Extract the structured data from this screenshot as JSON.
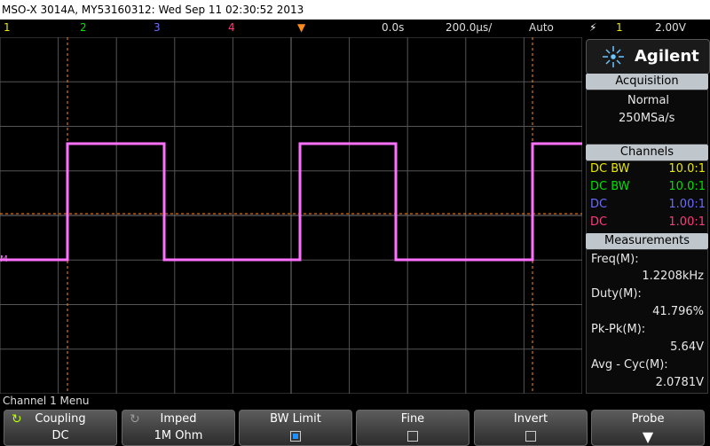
{
  "title_bar": "MSO-X 3014A, MY53160312: Wed Sep 11 02:30:52 2013",
  "top_bar": {
    "channels": [
      {
        "label": "1",
        "color": "#e8e800"
      },
      {
        "label": "2",
        "color": "#00e000"
      },
      {
        "label": "3",
        "color": "#6b6bff"
      },
      {
        "label": "4",
        "color": "#ff3a7a"
      }
    ],
    "time_delay": "0.0s",
    "time_scale": "200.0µs/",
    "trigger_mode": "Auto",
    "trigger_source": "1",
    "trigger_level": "2.00V"
  },
  "colors": {
    "trace": "#ff70ff",
    "cursor": "#ff8c1a",
    "grid": "#555555"
  },
  "brand": "Agilent",
  "acquisition": {
    "header": "Acquisition",
    "mode": "Normal",
    "rate": "250MSa/s"
  },
  "channels_panel": {
    "header": "Channels",
    "rows": [
      {
        "left": "DC BW",
        "right": "10.0:1",
        "color": "#e8e800"
      },
      {
        "left": "DC BW",
        "right": "10.0:1",
        "color": "#00e000"
      },
      {
        "left": "DC",
        "right": "1.00:1",
        "color": "#6b6bff"
      },
      {
        "left": "DC",
        "right": "1.00:1",
        "color": "#ff3a7a"
      }
    ]
  },
  "measurements": {
    "header": "Measurements",
    "items": [
      {
        "name": "Freq(M):",
        "value": "1.2208kHz"
      },
      {
        "name": "Duty(M):",
        "value": "41.796%"
      },
      {
        "name": "Pk-Pk(M):",
        "value": "5.64V"
      },
      {
        "name": "Avg - Cyc(M):",
        "value": "2.0781V"
      }
    ]
  },
  "bottom": {
    "menu_title": "Channel 1 Menu",
    "softkeys": [
      {
        "label": "Coupling",
        "value": "DC"
      },
      {
        "label": "Imped",
        "value": "1M Ohm"
      },
      {
        "label": "BW Limit",
        "value": ""
      },
      {
        "label": "Fine",
        "value": ""
      },
      {
        "label": "Invert",
        "value": ""
      },
      {
        "label": "Probe",
        "value": ""
      }
    ]
  },
  "waveform": {
    "high_level": "high",
    "low_level": "low"
  }
}
